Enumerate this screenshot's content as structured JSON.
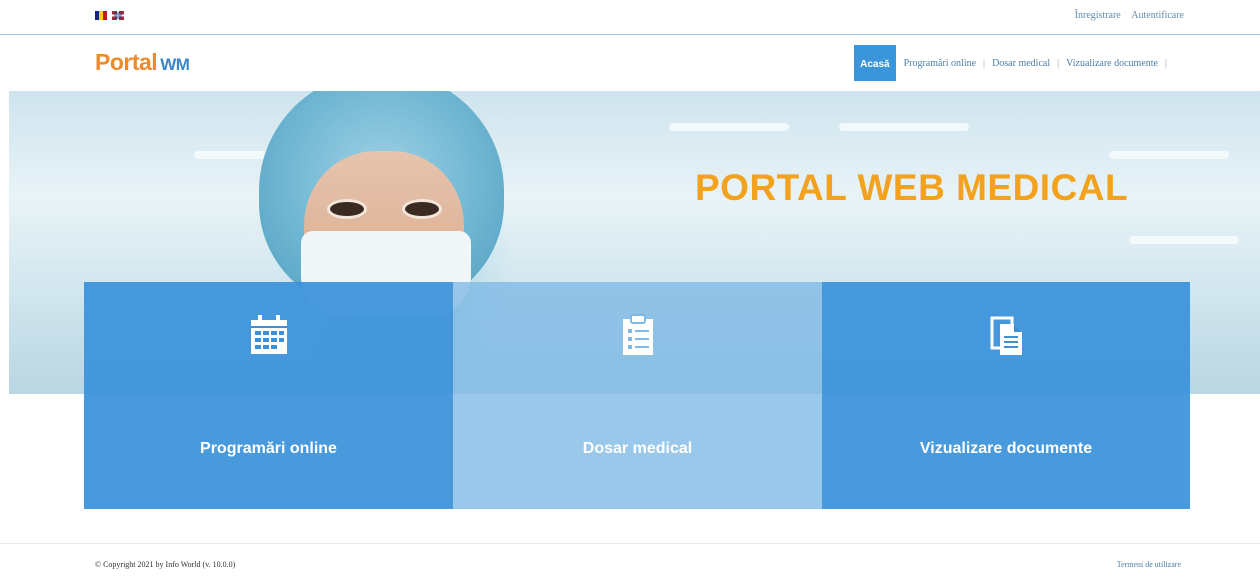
{
  "topbar": {
    "lang_ro": "RO",
    "lang_en": "EN",
    "register": "Înregistrare",
    "login": "Autentificare"
  },
  "header": {
    "logo_text": "Portal",
    "logo_mark": "WM",
    "nav": {
      "home": "Acasă",
      "appointments": "Programări online",
      "medical_record": "Dosar medical",
      "documents": "Vizualizare documente"
    }
  },
  "hero": {
    "title": "PORTAL WEB MEDICAL"
  },
  "tiles": [
    {
      "label": "Programări online",
      "icon": "calendar-icon"
    },
    {
      "label": "Dosar medical",
      "icon": "clipboard-icon"
    },
    {
      "label": "Vizualizare documente",
      "icon": "documents-icon"
    }
  ],
  "footer": {
    "copyright": "© Copyright 2021 by Info World (v. 10.0.0)",
    "terms": "Termeni de utilizare"
  },
  "colors": {
    "accent": "#3a95db",
    "title": "#f3a21e",
    "logo": "#ee8a2a"
  }
}
